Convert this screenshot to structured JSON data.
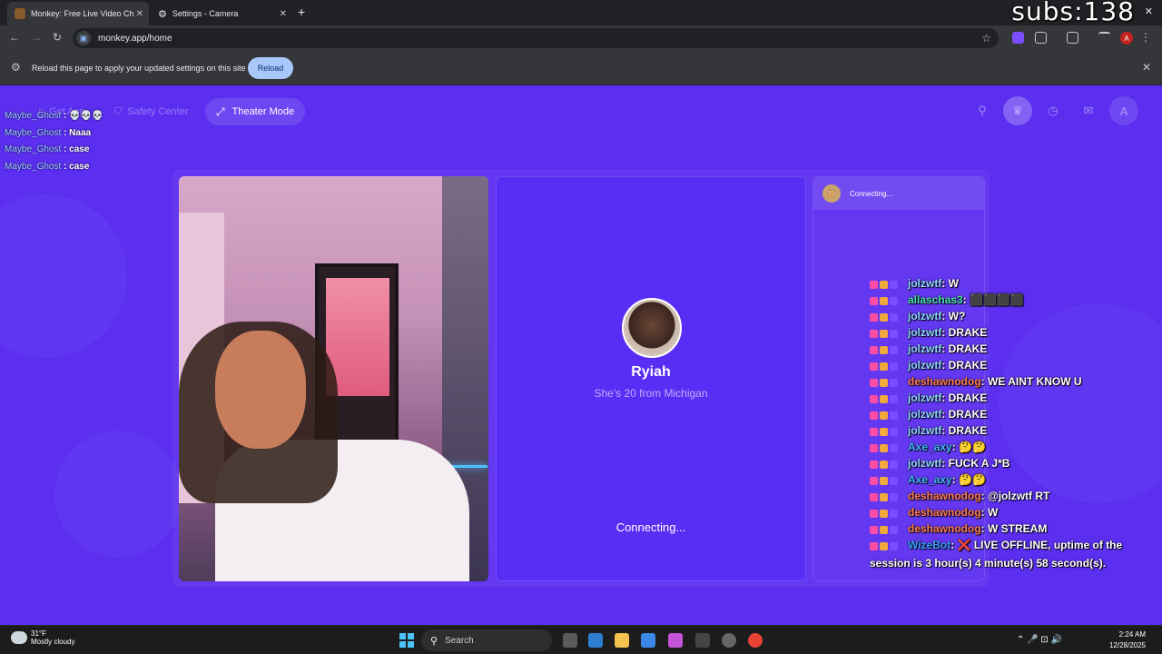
{
  "browser": {
    "tabs": [
      {
        "label": "Monkey: Free Live Video Ch",
        "active": true
      },
      {
        "label": "Settings - Camera",
        "active": false
      }
    ],
    "url": "monkey.app/home",
    "infobar": {
      "message": "Reload this page to apply your updated settings on this site",
      "button": "Reload"
    },
    "profile_initial": "A"
  },
  "stream": {
    "subs_counter": "subs:138"
  },
  "page": {
    "nav": {
      "get_app": "Get App",
      "safety_center": "Safety Center",
      "theater_mode": "Theater Mode",
      "user_initial": "A"
    },
    "match": {
      "name": "Ryiah",
      "description": "She's 20 from Michigan",
      "status": "Connecting..."
    },
    "chat": {
      "header": "Connecting..."
    }
  },
  "overlay_left": [
    {
      "user": "Maybe_Ghost",
      "msg": ": 💀💀💀"
    },
    {
      "user": "Maybe_Ghost",
      "msg": ": Naaa"
    },
    {
      "user": "Maybe_Ghost",
      "msg": ": case"
    },
    {
      "user": "Maybe_Ghost",
      "msg": ": case"
    }
  ],
  "overlay_right": [
    {
      "user": "jolzwtf",
      "color": "#8ed6ff",
      "msg": ": W"
    },
    {
      "user": "allaschas3",
      "color": "#44e3a6",
      "msg": ": ⬛⬛⬛⬛"
    },
    {
      "user": "jolzwtf",
      "color": "#8ed6ff",
      "msg": ": W?"
    },
    {
      "user": "jolzwtf",
      "color": "#8ed6ff",
      "msg": ": DRAKE"
    },
    {
      "user": "jolzwtf",
      "color": "#8ed6ff",
      "msg": ": DRAKE"
    },
    {
      "user": "jolzwtf",
      "color": "#8ed6ff",
      "msg": ": DRAKE"
    },
    {
      "user": "deshawnodog",
      "color": "#ff7a4d",
      "msg": ": WE AINT KNOW U"
    },
    {
      "user": "jolzwtf",
      "color": "#8ed6ff",
      "msg": ": DRAKE"
    },
    {
      "user": "jolzwtf",
      "color": "#8ed6ff",
      "msg": ": DRAKE"
    },
    {
      "user": "jolzwtf",
      "color": "#8ed6ff",
      "msg": ": DRAKE"
    },
    {
      "user": "Axe_axy",
      "color": "#3fb7ff",
      "msg": ": 🤔🤔"
    },
    {
      "user": "jolzwtf",
      "color": "#8ed6ff",
      "msg": ": FUCK A J*B"
    },
    {
      "user": "Axe_axy",
      "color": "#3fb7ff",
      "msg": ": 🤔🤔"
    },
    {
      "user": "deshawnodog",
      "color": "#ff7a4d",
      "msg": ": @jolzwtf RT"
    },
    {
      "user": "deshawnodog",
      "color": "#ff7a4d",
      "msg": ": W"
    },
    {
      "user": "deshawnodog",
      "color": "#ff7a4d",
      "msg": ": W STREAM"
    }
  ],
  "overlay_bot": {
    "user": "WizeBot",
    "color": "#39a0ff",
    "msg": ": ❌ LIVE OFFLINE, uptime of the session is 3 hour(s) 4 minute(s) 58 second(s)."
  },
  "taskbar": {
    "temp": "31°F",
    "weather": "Mostly cloudy",
    "search": "Search",
    "time": "2:24 AM",
    "date": "12/28/2025"
  },
  "colors": {
    "page_bg": "#5b2ef0",
    "accent_reload": "#a8c7fa"
  }
}
